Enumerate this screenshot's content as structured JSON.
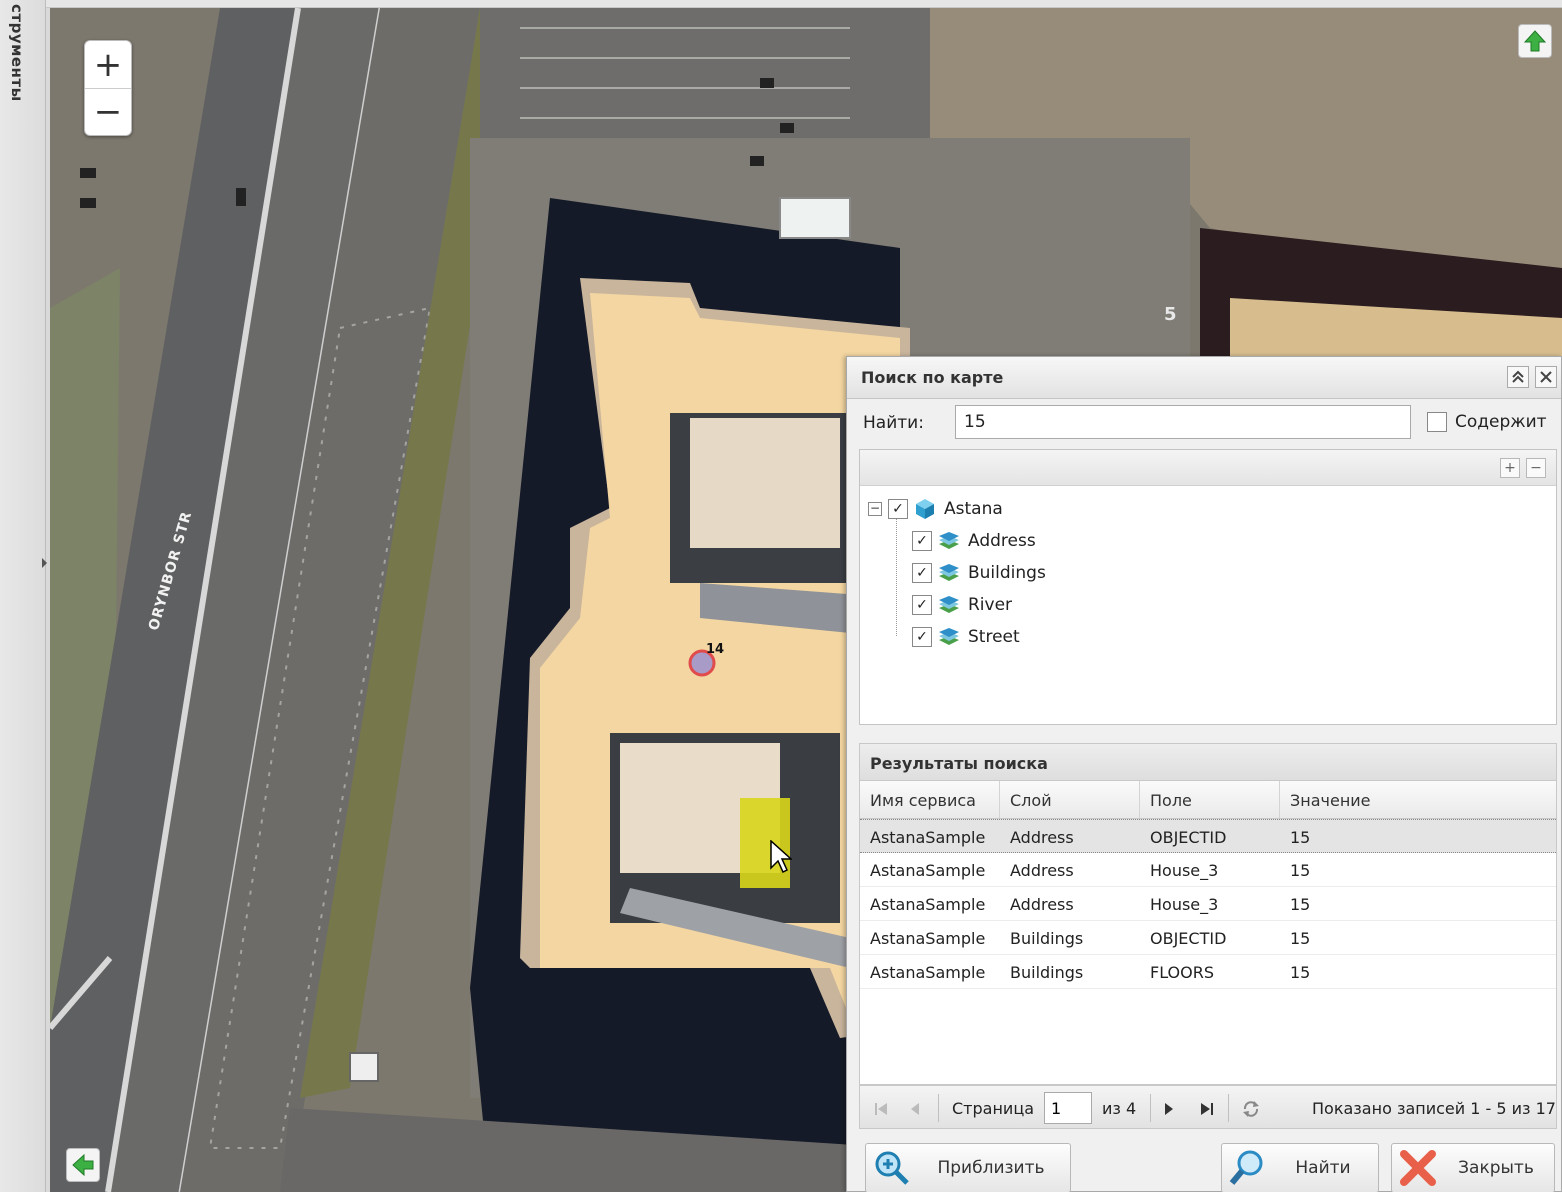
{
  "sidebar": {
    "vertical_label": "струменты"
  },
  "map": {
    "street_label": "ORYNBOR STR",
    "marker_label": "14",
    "house_number": "5",
    "zoom_in": "+",
    "zoom_out": "−"
  },
  "panel": {
    "title": "Поиск по карте",
    "find_label": "Найти:",
    "find_value": "15",
    "contains_label": "Содержит",
    "tree": {
      "root": "Astana",
      "children": [
        "Address",
        "Buildings",
        "River",
        "Street"
      ]
    },
    "results_title": "Результаты поиска",
    "columns": [
      "Имя сервиса",
      "Слой",
      "Поле",
      "Значение"
    ],
    "rows": [
      [
        "AstanaSample",
        "Address",
        "OBJECTID",
        "15"
      ],
      [
        "AstanaSample",
        "Address",
        "House_3",
        "15"
      ],
      [
        "AstanaSample",
        "Address",
        "House_3",
        "15"
      ],
      [
        "AstanaSample",
        "Buildings",
        "OBJECTID",
        "15"
      ],
      [
        "AstanaSample",
        "Buildings",
        "FLOORS",
        "15"
      ]
    ],
    "pager": {
      "page_label": "Страница",
      "page_value": "1",
      "of_label": "из 4",
      "status": "Показано записей 1 - 5 из 17"
    },
    "buttons": {
      "zoom_to": "Приблизить",
      "find": "Найти",
      "close": "Закрыть"
    }
  },
  "colors": {
    "building_fill": "#f6d9a2",
    "panel_bg": "#f0f0f0",
    "accent_green": "#3cb043"
  }
}
